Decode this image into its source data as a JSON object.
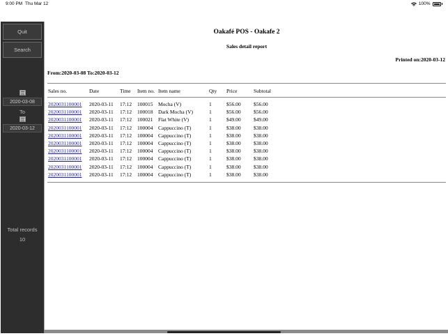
{
  "status_bar": {
    "time": "9:00 PM",
    "date": "Thu Mar 12",
    "battery": "100%"
  },
  "sidebar": {
    "quit_label": "Quit",
    "search_label": "Search",
    "from_date": "2020-03-08",
    "to_label": "To",
    "to_date": "2020-03-12",
    "calendar_icon_text": "31",
    "total_records_label": "Total records",
    "total_records_value": "10"
  },
  "report": {
    "title": "Oakafé POS - Oakafe 2",
    "subtitle": "Sales detail report",
    "printed_on": "Printed on:2020-03-12",
    "date_range": "From:2020-03-08 To:2020-03-12",
    "columns": [
      "Sales no.",
      "Date",
      "Time",
      "Item no.",
      "Item name",
      "Qty",
      "Price",
      "Subtotal"
    ],
    "rows": [
      [
        "2020031100001",
        "2020-03-11",
        "17:12",
        "100015",
        "Mocha (V)",
        "1",
        "$56.00",
        "$56.00"
      ],
      [
        "2020031100001",
        "2020-03-11",
        "17:12",
        "100018",
        "Dark Mocha (V)",
        "1",
        "$56.00",
        "$56.00"
      ],
      [
        "2020031100001",
        "2020-03-11",
        "17:12",
        "100021",
        "Flat White (V)",
        "1",
        "$49.00",
        "$49.00"
      ],
      [
        "2020031100001",
        "2020-03-11",
        "17:12",
        "100004",
        "Cappuccino (T)",
        "1",
        "$38.00",
        "$38.00"
      ],
      [
        "2020031100001",
        "2020-03-11",
        "17:12",
        "100004",
        "Cappuccino (T)",
        "1",
        "$38.00",
        "$38.00"
      ],
      [
        "2020031100001",
        "2020-03-11",
        "17:12",
        "100004",
        "Cappuccino (T)",
        "1",
        "$38.00",
        "$38.00"
      ],
      [
        "2020031100001",
        "2020-03-11",
        "17:12",
        "100004",
        "Cappuccino (T)",
        "1",
        "$38.00",
        "$38.00"
      ],
      [
        "2020031100001",
        "2020-03-11",
        "17:12",
        "100004",
        "Cappuccino (T)",
        "1",
        "$38.00",
        "$38.00"
      ],
      [
        "2020031100001",
        "2020-03-11",
        "17:12",
        "100004",
        "Cappuccino (T)",
        "1",
        "$38.00",
        "$38.00"
      ],
      [
        "2020031100001",
        "2020-03-11",
        "17:12",
        "100004",
        "Cappuccino (T)",
        "1",
        "$38.00",
        "$38.00"
      ]
    ]
  }
}
